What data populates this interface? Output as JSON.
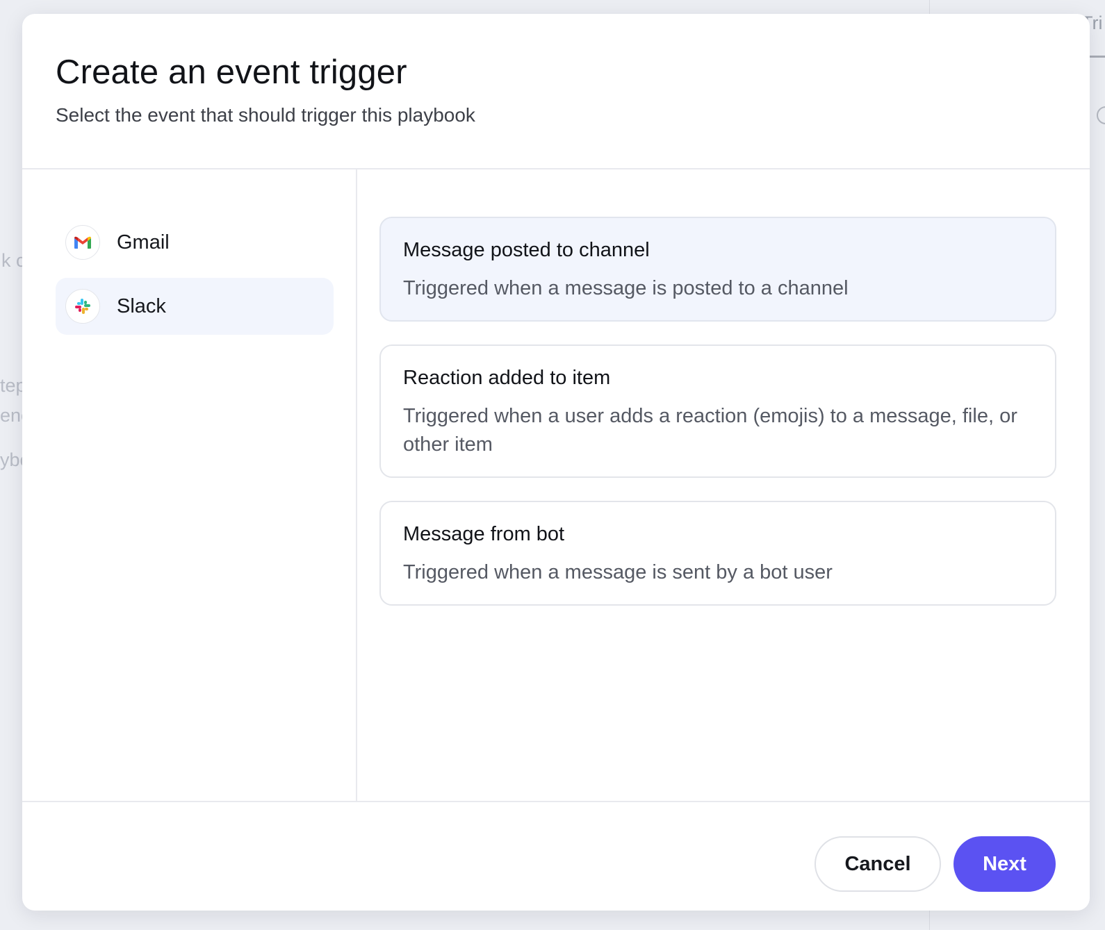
{
  "colors": {
    "accent": "#5b52f2",
    "selected_bg": "#f2f5fd",
    "border": "#e3e5ea"
  },
  "background": {
    "fragments": [
      "k c",
      "tep",
      "enc",
      "ybo"
    ],
    "tab_fragment": "Tri"
  },
  "modal": {
    "title": "Create an event trigger",
    "subtitle": "Select the event that should trigger this playbook"
  },
  "apps": [
    {
      "label": "Gmail",
      "icon": "gmail-icon",
      "selected": false
    },
    {
      "label": "Slack",
      "icon": "slack-icon",
      "selected": true
    }
  ],
  "events": [
    {
      "title": "Message posted to channel",
      "description": "Triggered when a message is posted to a channel",
      "selected": true
    },
    {
      "title": "Reaction added to item",
      "description": "Triggered when a user adds a reaction (emojis) to a message, file, or other item",
      "selected": false
    },
    {
      "title": "Message from bot",
      "description": "Triggered when a message is sent by a bot user",
      "selected": false
    }
  ],
  "footer": {
    "cancel_label": "Cancel",
    "next_label": "Next"
  }
}
